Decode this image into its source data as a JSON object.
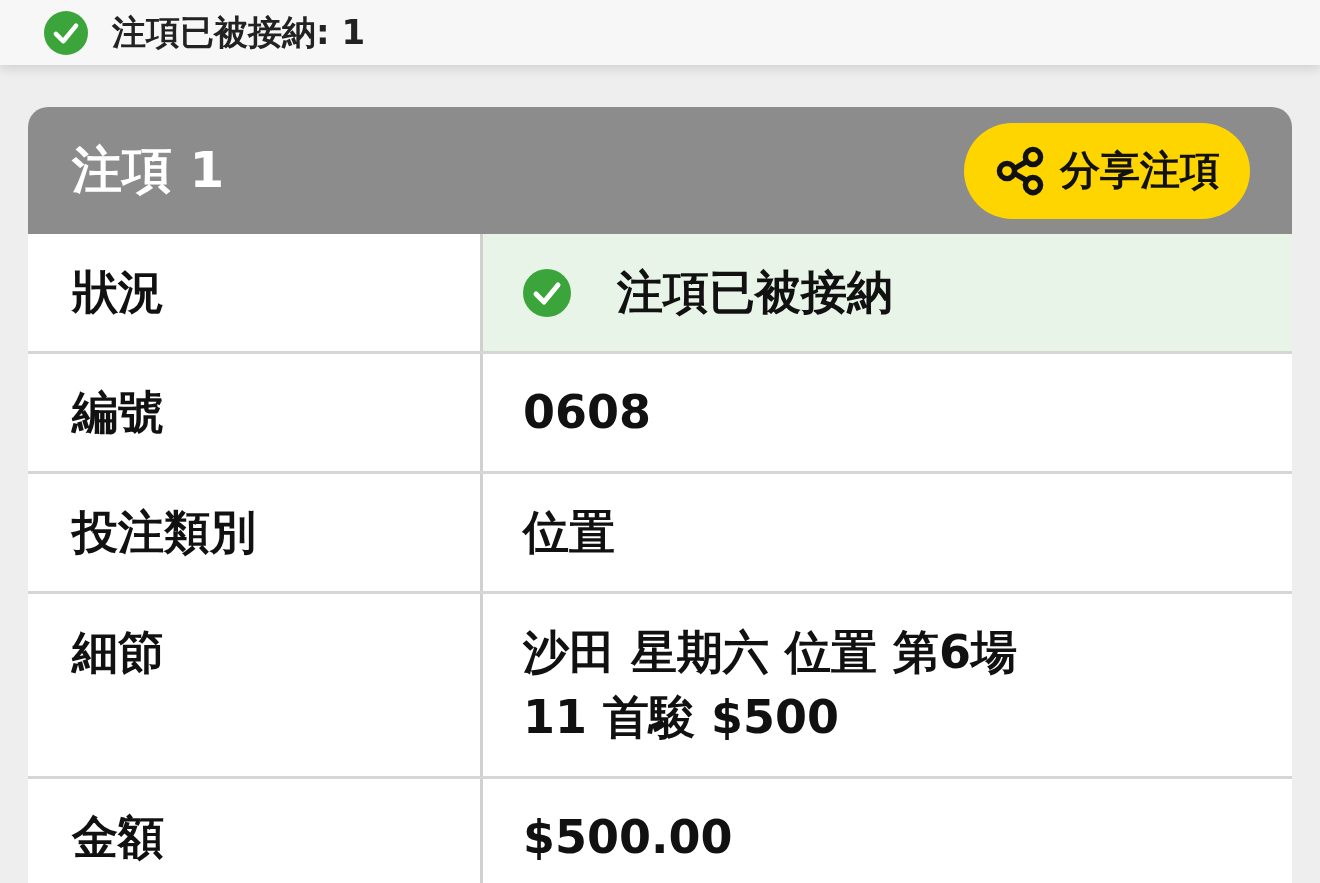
{
  "summary": {
    "text": "注項已被接納: 1",
    "kind": "accepted"
  },
  "card": {
    "title": "注項 1",
    "share_button": "分享注項",
    "rows": [
      {
        "label": "狀況",
        "value": "注項已被接納",
        "kind": "status"
      },
      {
        "label": "編號",
        "value": "0608",
        "kind": "text"
      },
      {
        "label": "投注類別",
        "value": "位置",
        "kind": "text"
      },
      {
        "label": "細節",
        "value": "沙田 星期六 位置 第6場\n11 首駿 $500",
        "kind": "text"
      },
      {
        "label": "金額",
        "value": "$500.00",
        "kind": "text"
      }
    ]
  }
}
